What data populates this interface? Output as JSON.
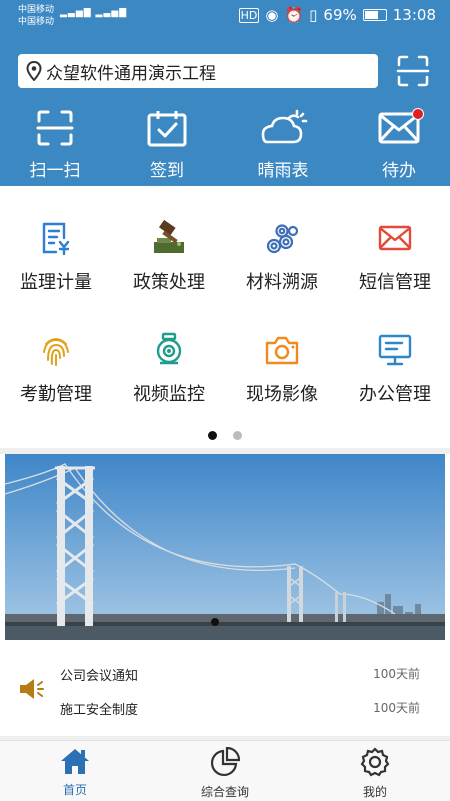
{
  "status": {
    "carrier1": "中国移动",
    "carrier2": "中国移动",
    "hd": "HD",
    "battery": "69%",
    "time": "13:08"
  },
  "search": {
    "text": "众望软件通用演示工程"
  },
  "quick_actions": [
    {
      "label": "扫一扫",
      "icon": "scan-icon"
    },
    {
      "label": "签到",
      "icon": "calendar-check-icon"
    },
    {
      "label": "晴雨表",
      "icon": "weather-icon"
    },
    {
      "label": "待办",
      "icon": "mail-icon"
    }
  ],
  "grid": [
    {
      "label": "监理计量",
      "icon": "invoice-icon",
      "color": "#2f7fd0"
    },
    {
      "label": "政策处理",
      "icon": "gavel-icon",
      "color": "#4f6b2f"
    },
    {
      "label": "材料溯源",
      "icon": "pipes-icon",
      "color": "#3c6fb5"
    },
    {
      "label": "短信管理",
      "icon": "envelope-icon",
      "color": "#e24a3a"
    },
    {
      "label": "考勤管理",
      "icon": "fingerprint-icon",
      "color": "#e0a21c"
    },
    {
      "label": "视频监控",
      "icon": "camera-cctv-icon",
      "color": "#1f9c8a"
    },
    {
      "label": "现场影像",
      "icon": "photo-camera-icon",
      "color": "#f08a1e"
    },
    {
      "label": "办公管理",
      "icon": "monitor-icon",
      "color": "#2d87c9"
    }
  ],
  "notices": [
    {
      "title": "公司会议通知",
      "time": "100天前"
    },
    {
      "title": "施工安全制度",
      "time": "100天前"
    }
  ],
  "tabs": [
    {
      "label": "首页",
      "icon": "home-icon",
      "active": true
    },
    {
      "label": "综合查询",
      "icon": "pie-chart-icon",
      "active": false
    },
    {
      "label": "我的",
      "icon": "settings-icon",
      "active": false
    }
  ]
}
